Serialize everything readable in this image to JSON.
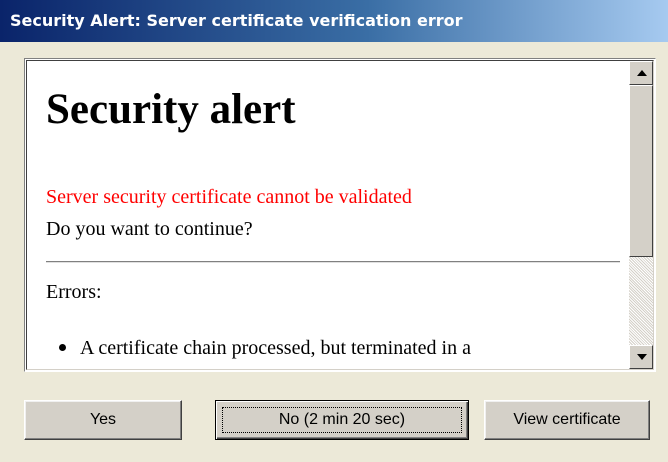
{
  "window": {
    "title": "Security Alert: Server certificate verification error"
  },
  "content": {
    "heading": "Security alert",
    "warning": "Server security certificate cannot be validated",
    "question": "Do you want to continue?",
    "errors_label": "Errors:",
    "errors": [
      "A certificate chain processed, but terminated in a"
    ]
  },
  "buttons": {
    "yes": "Yes",
    "no": "No (2 min 20 sec)",
    "view_certificate": "View certificate"
  },
  "colors": {
    "warning": "#ff0000",
    "titlebar_start": "#0a246a",
    "titlebar_end": "#a6caf0",
    "face": "#d4d0c8"
  },
  "icons": {
    "scroll_up": "triangle-up",
    "scroll_down": "triangle-down",
    "bullet": "disc"
  }
}
